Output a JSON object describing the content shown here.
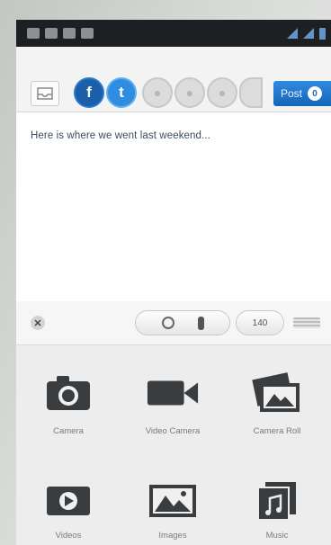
{
  "networks": {
    "facebook_icon": "f",
    "twitter_icon": "t",
    "post_label": "Post",
    "post_count": "0"
  },
  "compose": {
    "text": "Here is where we went last weekend..."
  },
  "attachments": {
    "close_icon": "✕",
    "char_counter": "140"
  },
  "media": {
    "items": [
      {
        "label": "Camera",
        "icon": "camera-icon"
      },
      {
        "label": "Video Camera",
        "icon": "video-camera-icon"
      },
      {
        "label": "Camera Roll",
        "icon": "camera-roll-icon"
      },
      {
        "label": "Videos",
        "icon": "videos-icon"
      },
      {
        "label": "Images",
        "icon": "images-icon"
      },
      {
        "label": "Music",
        "icon": "music-icon"
      }
    ]
  },
  "colors": {
    "accent": "#1b6fc4",
    "status_bar": "#1d1f22",
    "facebook": "#1b5fa8",
    "twitter": "#2e8de0"
  }
}
